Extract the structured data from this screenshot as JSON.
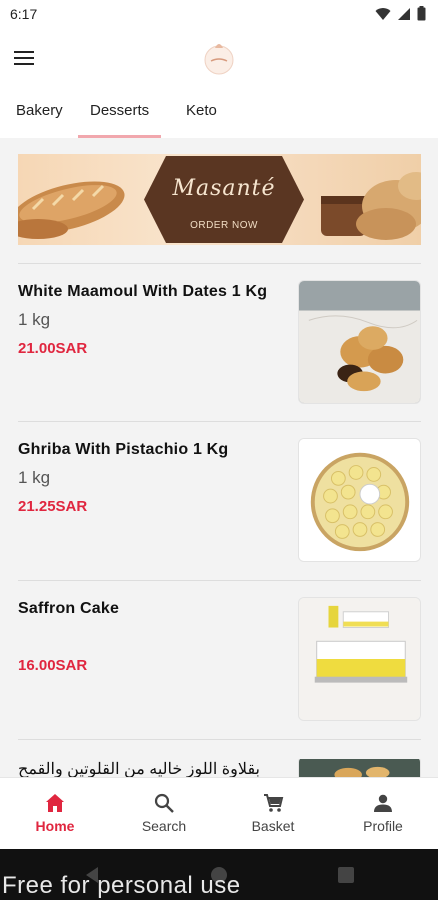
{
  "status_bar": {
    "time": "6:17",
    "icons": [
      "wifi-icon",
      "signal-icon",
      "battery-icon"
    ]
  },
  "app_bar": {
    "menu_icon": "menu-icon",
    "logo_icon": "masante-logo-icon"
  },
  "tabs": [
    {
      "label": "Bakery",
      "active": false
    },
    {
      "label": "Desserts",
      "active": true
    },
    {
      "label": "Keto",
      "active": false
    }
  ],
  "banner": {
    "brand": "Masanté",
    "cta": "ORDER NOW"
  },
  "products": [
    {
      "name": "White Maamoul With Dates 1 Kg",
      "weight": "1 kg",
      "price": "21.00SAR"
    },
    {
      "name": "Ghriba With Pistachio 1 Kg",
      "weight": "1 kg",
      "price": "21.25SAR"
    },
    {
      "name": "Saffron Cake",
      "weight": "",
      "price": "16.00SAR"
    },
    {
      "name": "بقلاوة اللوز خاليه من القلوتين والقمح",
      "weight": "",
      "price": ""
    }
  ],
  "bottom_nav": [
    {
      "label": "Home",
      "icon": "home-icon",
      "active": true
    },
    {
      "label": "Search",
      "icon": "search-icon",
      "active": false
    },
    {
      "label": "Basket",
      "icon": "cart-icon",
      "active": false
    },
    {
      "label": "Profile",
      "icon": "person-icon",
      "active": false
    }
  ],
  "watermark": "Free for personal use",
  "colors": {
    "accent": "#e0263f",
    "tab_indicator": "#f1a7ad",
    "banner_brown": "#5a3622"
  }
}
